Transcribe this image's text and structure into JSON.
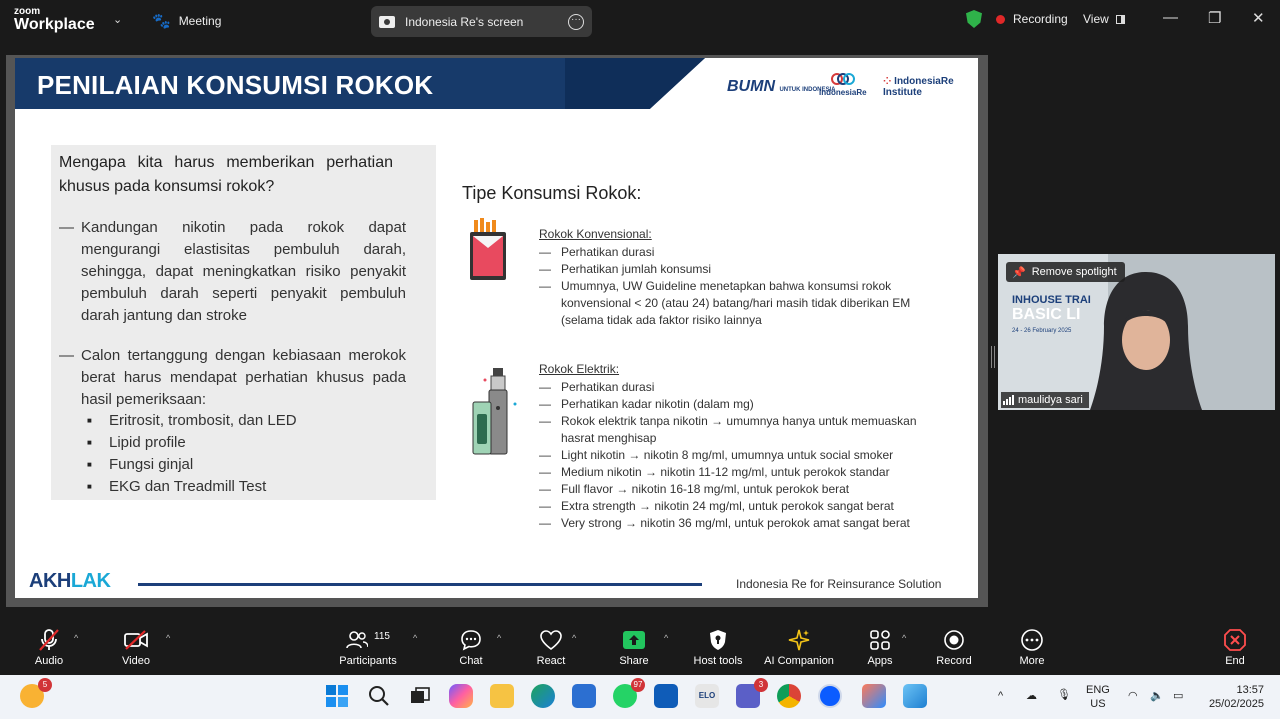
{
  "app": {
    "brand_line1": "zoom",
    "brand_line2": "Workplace",
    "meeting_label": "Meeting",
    "share_title": "Indonesia Re's screen",
    "recording_label": "Recording",
    "view_label": "View"
  },
  "slide": {
    "title": "PENILAIAN KONSUMSI ROKOK",
    "logo_bumn": "BUMN",
    "logo_bumn_sub": "UNTUK INDONESIA",
    "logo_ire": "IndonesiaRe",
    "logo_iri": "IndonesiaRe Institute",
    "question": "Mengapa kita harus memberikan perhatian khusus pada konsumsi rokok?",
    "left_bullets": [
      "Kandungan nikotin pada rokok dapat mengurangi elastisitas pembuluh darah, sehingga, dapat meningkatkan risiko penyakit pembuluh darah seperti penyakit pembuluh darah jantung dan stroke",
      "Calon tertanggung dengan kebiasaan merokok berat harus mendapat perhatian khusus pada hasil pemeriksaan:"
    ],
    "sub_bullets": [
      "Eritrosit, trombosit, dan LED",
      "Lipid profile",
      "Fungsi ginjal",
      "EKG dan Treadmill Test"
    ],
    "tipe_heading": "Tipe Konsumsi Rokok:",
    "konvensional": {
      "heading": "Rokok Konvensional:",
      "items": [
        "Perhatikan durasi",
        "Perhatikan jumlah konsumsi",
        "Umumnya, UW Guideline menetapkan bahwa konsumsi rokok konvensional < 20 (atau 24) batang/hari masih tidak diberikan EM (selama tidak ada faktor risiko lainnya"
      ]
    },
    "elektrik": {
      "heading": "Rokok Elektrik:",
      "items": [
        "Perhatikan durasi",
        "Perhatikan kadar nikotin (dalam mg)",
        "Rokok elektrik tanpa nikotin → umumnya hanya untuk memuaskan hasrat menghisap",
        "Light nikotin → nikotin 8 mg/ml, umumnya untuk social smoker",
        "Medium nikotin → nikotin 11-12 mg/ml, untuk perokok standar",
        "Full flavor → nikotin 16-18 mg/ml, untuk perokok berat",
        "Extra strength → nikotin 24 mg/ml, untuk perokok sangat berat",
        "Very strong → nikotin 36 mg/ml, untuk perokok amat sangat berat"
      ]
    },
    "footer_logo_a": "AKH",
    "footer_logo_b": "LAK",
    "footer_text": "Indonesia Re for Reinsurance Solution"
  },
  "video": {
    "remove_spotlight": "Remove spotlight",
    "participant_name": "maulidya sari",
    "banner_small": "INHOUSE TRAI",
    "banner_big": "BASIC LI",
    "banner_date": "24 - 26 February 2025"
  },
  "toolbar": {
    "audio": "Audio",
    "video": "Video",
    "participants": "Participants",
    "participants_count": "115",
    "chat": "Chat",
    "react": "React",
    "share": "Share",
    "host_tools": "Host tools",
    "ai_companion": "AI Companion",
    "apps": "Apps",
    "record": "Record",
    "more": "More",
    "end": "End"
  },
  "taskbar": {
    "weather_badge": "5",
    "whatsapp_badge": "97",
    "teams_badge": "3",
    "elo_label": "ELO",
    "lang_line1": "ENG",
    "lang_line2": "US",
    "time": "13:57",
    "date": "25/02/2025"
  }
}
